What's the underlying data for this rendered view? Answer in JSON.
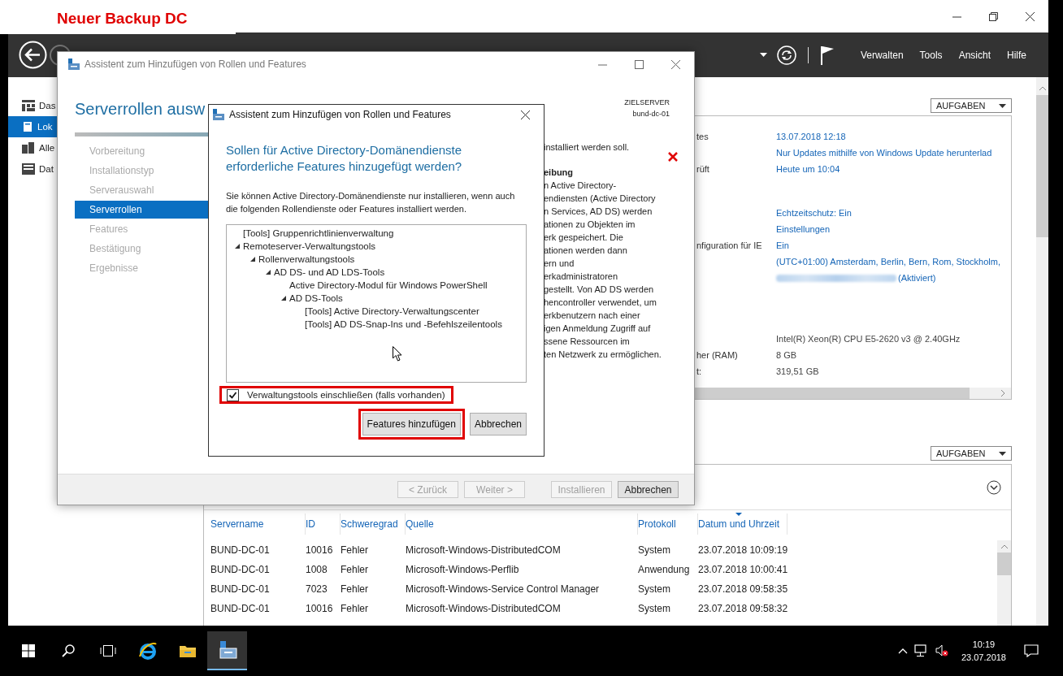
{
  "annotation": {
    "label": "Neuer Backup DC"
  },
  "server_manager": {
    "menu": [
      "Verwalten",
      "Tools",
      "Ansicht",
      "Hilfe"
    ],
    "sidebar": [
      {
        "label": "Das",
        "selected": false
      },
      {
        "label": "Lok",
        "selected": true
      },
      {
        "label": "Alle",
        "selected": false
      },
      {
        "label": "Dat",
        "selected": false
      }
    ],
    "tasks_button": "AUFGABEN",
    "property_groups": [
      {
        "rows": [
          {
            "label": "tes",
            "value": "13.07.2018 12:18",
            "kind": "link"
          },
          {
            "value": "Nur Updates mithilfe von Windows Update herunterlad",
            "kind": "link"
          },
          {
            "label": "rüft",
            "value": "Heute um 10:04",
            "kind": "link"
          }
        ]
      },
      {
        "rows": [
          {
            "value": "Echtzeitschutz: Ein",
            "kind": "link"
          },
          {
            "value": "Einstellungen",
            "kind": "link"
          },
          {
            "label": "nfiguration für IE",
            "value": "Ein",
            "kind": "link"
          },
          {
            "value": "(UTC+01:00) Amsterdam, Berlin, Bern, Rom, Stockholm,",
            "kind": "link"
          },
          {
            "value": "(Aktiviert)",
            "kind": "masked-link"
          }
        ]
      },
      {
        "rows": [
          {
            "value": "Intel(R) Xeon(R) CPU E5-2620 v3 @ 2.40GHz",
            "kind": "plain"
          },
          {
            "label": "her (RAM)",
            "value": "8 GB",
            "kind": "plain"
          },
          {
            "label": "t:",
            "value": "319,51 GB",
            "kind": "plain"
          }
        ]
      }
    ],
    "events": {
      "tasks_button": "AUFGABEN",
      "columns": [
        {
          "label": "Servername",
          "sorted": false
        },
        {
          "label": "ID",
          "sorted": false
        },
        {
          "label": "Schweregrad",
          "sorted": false
        },
        {
          "label": "Quelle",
          "sorted": false
        },
        {
          "label": "Protokoll",
          "sorted": false
        },
        {
          "label": "Datum und Uhrzeit",
          "sorted": true
        }
      ],
      "rows": [
        [
          "BUND-DC-01",
          "10016",
          "Fehler",
          "Microsoft-Windows-DistributedCOM",
          "System",
          "23.07.2018 10:09:19"
        ],
        [
          "BUND-DC-01",
          "1008",
          "Fehler",
          "Microsoft-Windows-Perflib",
          "Anwendung",
          "23.07.2018 10:00:41"
        ],
        [
          "BUND-DC-01",
          "7023",
          "Fehler",
          "Microsoft-Windows-Service Control Manager",
          "System",
          "23.07.2018 09:58:35"
        ],
        [
          "BUND-DC-01",
          "10016",
          "Fehler",
          "Microsoft-Windows-DistributedCOM",
          "System",
          "23.07.2018 09:58:32"
        ]
      ]
    }
  },
  "wizard": {
    "title": "Assistent zum Hinzufügen von Rollen und Features",
    "heading": "Serverrollen ausw",
    "target_label": "ZIELSERVER",
    "target_server": "bund-dc-01",
    "steps": [
      {
        "label": "Vorbereitung",
        "selected": false
      },
      {
        "label": "Installationstyp",
        "selected": false
      },
      {
        "label": "Serverauswahl",
        "selected": false
      },
      {
        "label": "Serverrollen",
        "selected": true
      },
      {
        "label": "Features",
        "selected": false
      },
      {
        "label": "Bestätigung",
        "selected": false
      },
      {
        "label": "Ergebnisse",
        "selected": false
      }
    ],
    "note": "installiert werden soll.",
    "description_heading": "eibung",
    "description_lines": [
      "n Active Directory-",
      "endiensten (Active Directory",
      "n Services, AD DS) werden",
      "ationen zu Objekten im",
      "erk gespeichert. Die",
      "ationen werden dann",
      "ern und",
      "erkadministratoren",
      "gestellt. Von AD DS werden",
      "hencontroller verwendet, um",
      "erkbenutzern nach einer",
      "igen Anmeldung Zugriff auf",
      "ssene Ressourcen im",
      "ten Netzwerk zu ermöglichen."
    ],
    "buttons": [
      {
        "label": "< Zurück",
        "disabled": true
      },
      {
        "label": "Weiter >",
        "disabled": true
      },
      {
        "label": "Installieren",
        "disabled": true
      },
      {
        "label": "Abbrechen",
        "disabled": false
      }
    ]
  },
  "dialog": {
    "title": "Assistent zum Hinzufügen von Rollen und Features",
    "question": "Sollen für Active Directory-Domänendienste erforderliche Features hinzugefügt werden?",
    "message": "Sie können Active Directory-Domänendienste nur installieren, wenn auch die folgenden Rollendienste oder Features installiert werden.",
    "tree": [
      {
        "label": "[Tools] Gruppenrichtlinienverwaltung",
        "expanded": false
      },
      {
        "label": "Remoteserver-Verwaltungstools",
        "expanded": true,
        "children": [
          {
            "label": "Rollenverwaltungstools",
            "expanded": true,
            "children": [
              {
                "label": "AD DS- und AD LDS-Tools",
                "expanded": true,
                "children": [
                  {
                    "label": "Active Directory-Modul für Windows PowerShell",
                    "expanded": false
                  },
                  {
                    "label": "AD DS-Tools",
                    "expanded": true,
                    "children": [
                      {
                        "label": "[Tools] Active Directory-Verwaltungscenter",
                        "expanded": false
                      },
                      {
                        "label": "[Tools] AD DS-Snap-Ins und -Befehlszeilentools",
                        "expanded": false
                      }
                    ]
                  }
                ]
              }
            ]
          }
        ]
      }
    ],
    "include_tools": {
      "label": "Verwaltungstools einschließen (falls vorhanden)",
      "checked": true,
      "annotated": true
    },
    "buttons": [
      {
        "label": "Features hinzufügen",
        "annotated": true
      },
      {
        "label": "Abbrechen",
        "annotated": false
      }
    ]
  },
  "taskbar": {
    "time": "10:19",
    "date": "23.07.2018"
  }
}
